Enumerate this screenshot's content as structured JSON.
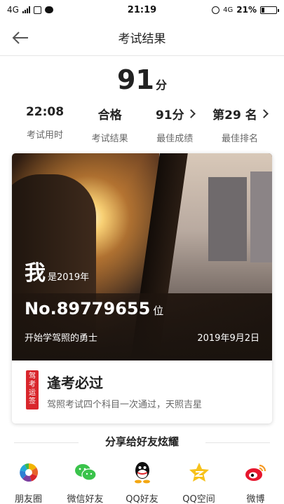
{
  "status_bar": {
    "left": "4G",
    "time": "21:19",
    "network": "4G",
    "battery": "21%",
    "battery_fraction": 0.21
  },
  "nav": {
    "title": "考试结果"
  },
  "score": {
    "value": "91",
    "unit": "分"
  },
  "stats": [
    {
      "value": "22:08",
      "label": "考试用时",
      "has_arrow": false
    },
    {
      "value": "合格",
      "label": "考试结果",
      "has_arrow": false
    },
    {
      "value": "91分",
      "label": "最佳成绩",
      "has_arrow": true
    },
    {
      "value": "第29 名",
      "label": "最佳排名",
      "has_arrow": true
    }
  ],
  "card": {
    "me": "我",
    "me_suffix": "是2019年",
    "rank_number": "No.89779655",
    "rank_unit": "位",
    "footer_left": "开始学驾照的勇士",
    "footer_right": "2019年9月2日",
    "stamp_text": "驾考运签",
    "title": "逢考必过",
    "desc": "驾照考试四个科目一次通过，天照吉星"
  },
  "share": {
    "title": "分享给好友炫耀",
    "items": [
      {
        "label": "朋友圈",
        "icon": "moments-icon"
      },
      {
        "label": "微信好友",
        "icon": "wechat-icon"
      },
      {
        "label": "QQ好友",
        "icon": "qq-icon"
      },
      {
        "label": "QQ空间",
        "icon": "qzone-icon"
      },
      {
        "label": "微博",
        "icon": "weibo-icon"
      }
    ]
  },
  "colors": {
    "accent_red": "#d9262c",
    "text": "#222222",
    "muted": "#666666"
  }
}
